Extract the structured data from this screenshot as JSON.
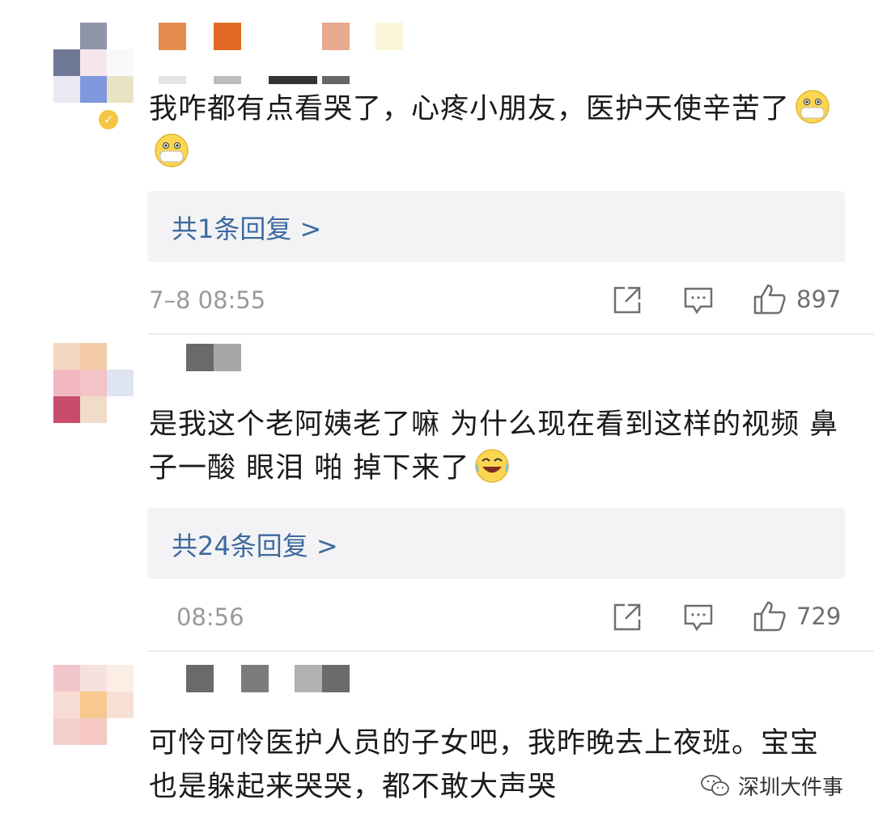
{
  "comments": [
    {
      "text": "我咋都有点看哭了，心疼小朋友，医护天使辛苦了",
      "emojis": [
        "mask-face",
        "mask-face"
      ],
      "reply_label": "共1条回复 >",
      "time": "7–8 08:55",
      "likes": "897",
      "verified": true
    },
    {
      "text": "是我这个老阿姨老了嘛 为什么现在看到这样的视频 鼻子一酸 眼泪 啪 掉下来了",
      "emojis": [
        "laugh-cry-face"
      ],
      "reply_label": "共24条回复 >",
      "time": "⁠08:56",
      "likes": "729",
      "verified": false
    },
    {
      "text": "可怜可怜医护人员的子女吧，我昨晚去上夜班。宝宝也是躲起来哭哭，都不敢大声哭",
      "emojis": [],
      "verified": false
    }
  ],
  "watermark": {
    "text": "深圳大件事",
    "icon": "wechat-icon"
  },
  "colors": {
    "link": "#3d6a9f",
    "reply_bg": "#f3f3f5",
    "meta": "#9a9a9a"
  }
}
